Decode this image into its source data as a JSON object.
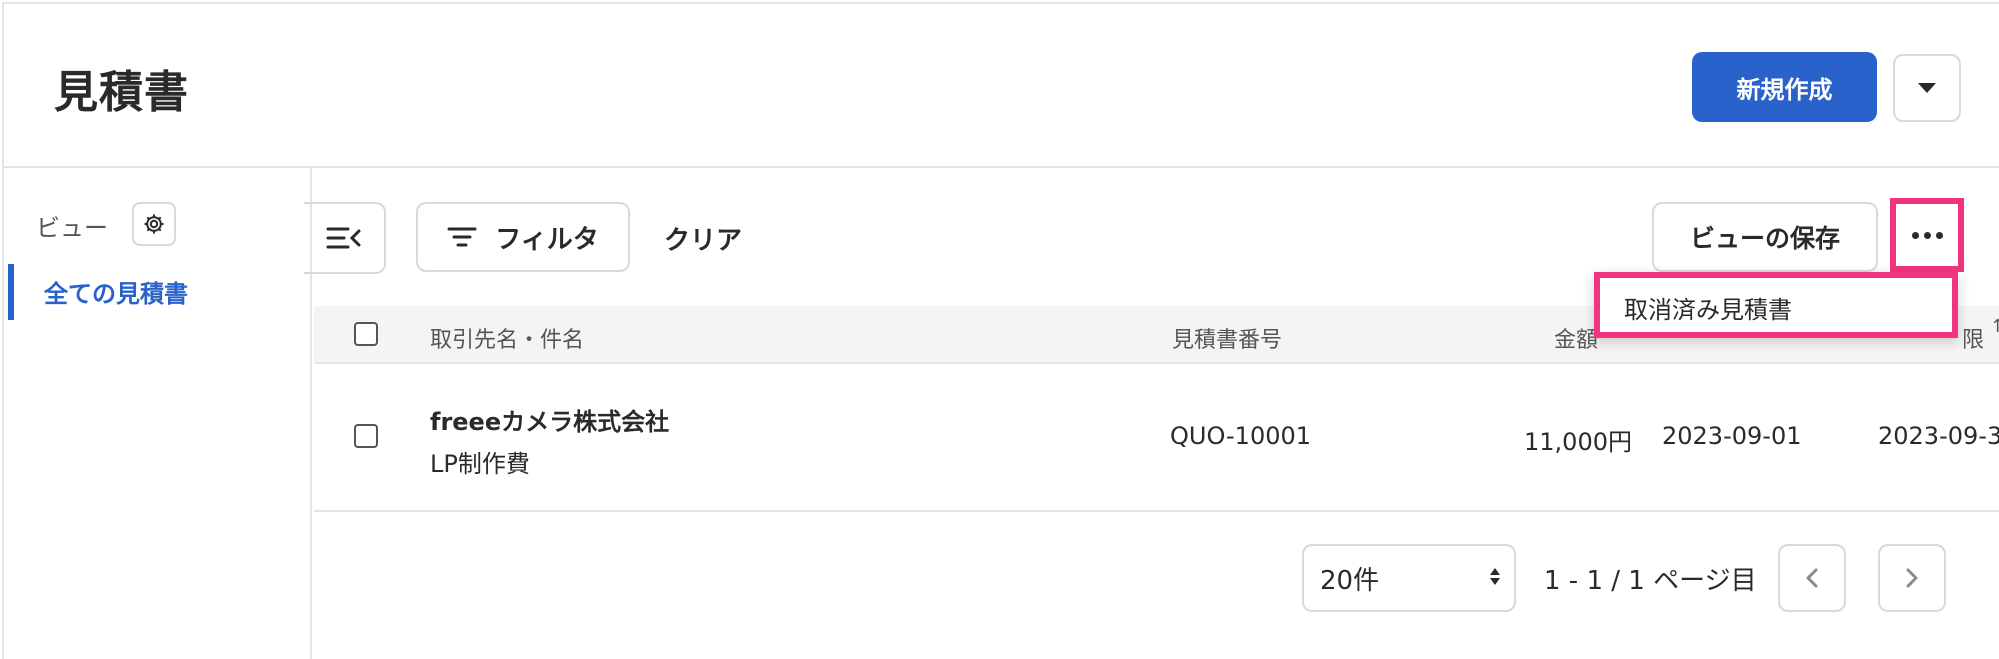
{
  "header": {
    "title": "見積書",
    "new_button": "新規作成"
  },
  "sidebar": {
    "view_label": "ビュー",
    "items": [
      {
        "label": "全ての見積書",
        "active": true
      }
    ]
  },
  "toolbar": {
    "filter_label": "フィルタ",
    "clear_label": "クリア",
    "save_view_label": "ビューの保存"
  },
  "more_menu": {
    "items": [
      {
        "label": "取消済み見積書"
      }
    ]
  },
  "table": {
    "columns": {
      "client_subject": "取引先名・件名",
      "quote_number": "見積書番号",
      "amount": "金額",
      "expiry_partial": "限",
      "sort_indicator": "↑"
    },
    "rows": [
      {
        "client": "freeeカメラ株式会社",
        "subject": "LP制作費",
        "quote_number": "QUO-10001",
        "amount": "11,000円",
        "issue_date": "2023-09-01",
        "expiry_date": "2023-09-3"
      }
    ]
  },
  "pagination": {
    "per_page": "20件",
    "info": "1 - 1 / 1 ページ目"
  },
  "colors": {
    "accent": "#2a62cc",
    "highlight": "#f0357e"
  }
}
